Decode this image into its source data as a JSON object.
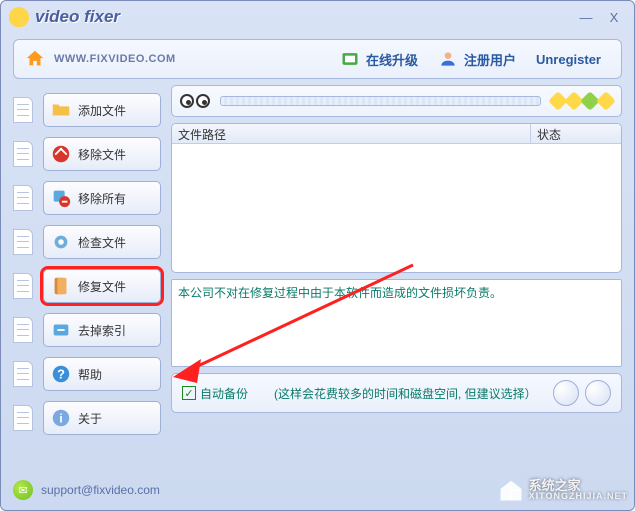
{
  "app": {
    "title": "video fixer",
    "domain": "WWW.FIXVIDEO.COM"
  },
  "window_controls": {
    "minimize": "—",
    "close": "X"
  },
  "top_links": {
    "upgrade": "在线升级",
    "register": "注册用户",
    "unregister": "Unregister"
  },
  "sidebar": {
    "items": [
      {
        "label": "添加文件",
        "icon": "folder-add-icon"
      },
      {
        "label": "移除文件",
        "icon": "remove-icon"
      },
      {
        "label": "移除所有",
        "icon": "remove-all-icon"
      },
      {
        "label": "检查文件",
        "icon": "check-icon"
      },
      {
        "label": "修复文件",
        "icon": "repair-icon"
      },
      {
        "label": "去掉索引",
        "icon": "index-remove-icon"
      },
      {
        "label": "帮助",
        "icon": "help-icon"
      },
      {
        "label": "关于",
        "icon": "about-icon"
      }
    ],
    "highlighted_index": 4
  },
  "table": {
    "columns": {
      "path": "文件路径",
      "status": "状态"
    },
    "rows": []
  },
  "message": "本公司不对在修复过程中由于本软件而造成的文件损坏负责。",
  "autobackup": {
    "checked": true,
    "label": "自动备份",
    "hint": "(这样会花费较多的时间和磁盘空间, 但建议选择）"
  },
  "footer": {
    "email": "support@fixvideo.com"
  },
  "watermark": {
    "title": "系统之家",
    "sub": "XITONGZHIJIA.NET"
  }
}
